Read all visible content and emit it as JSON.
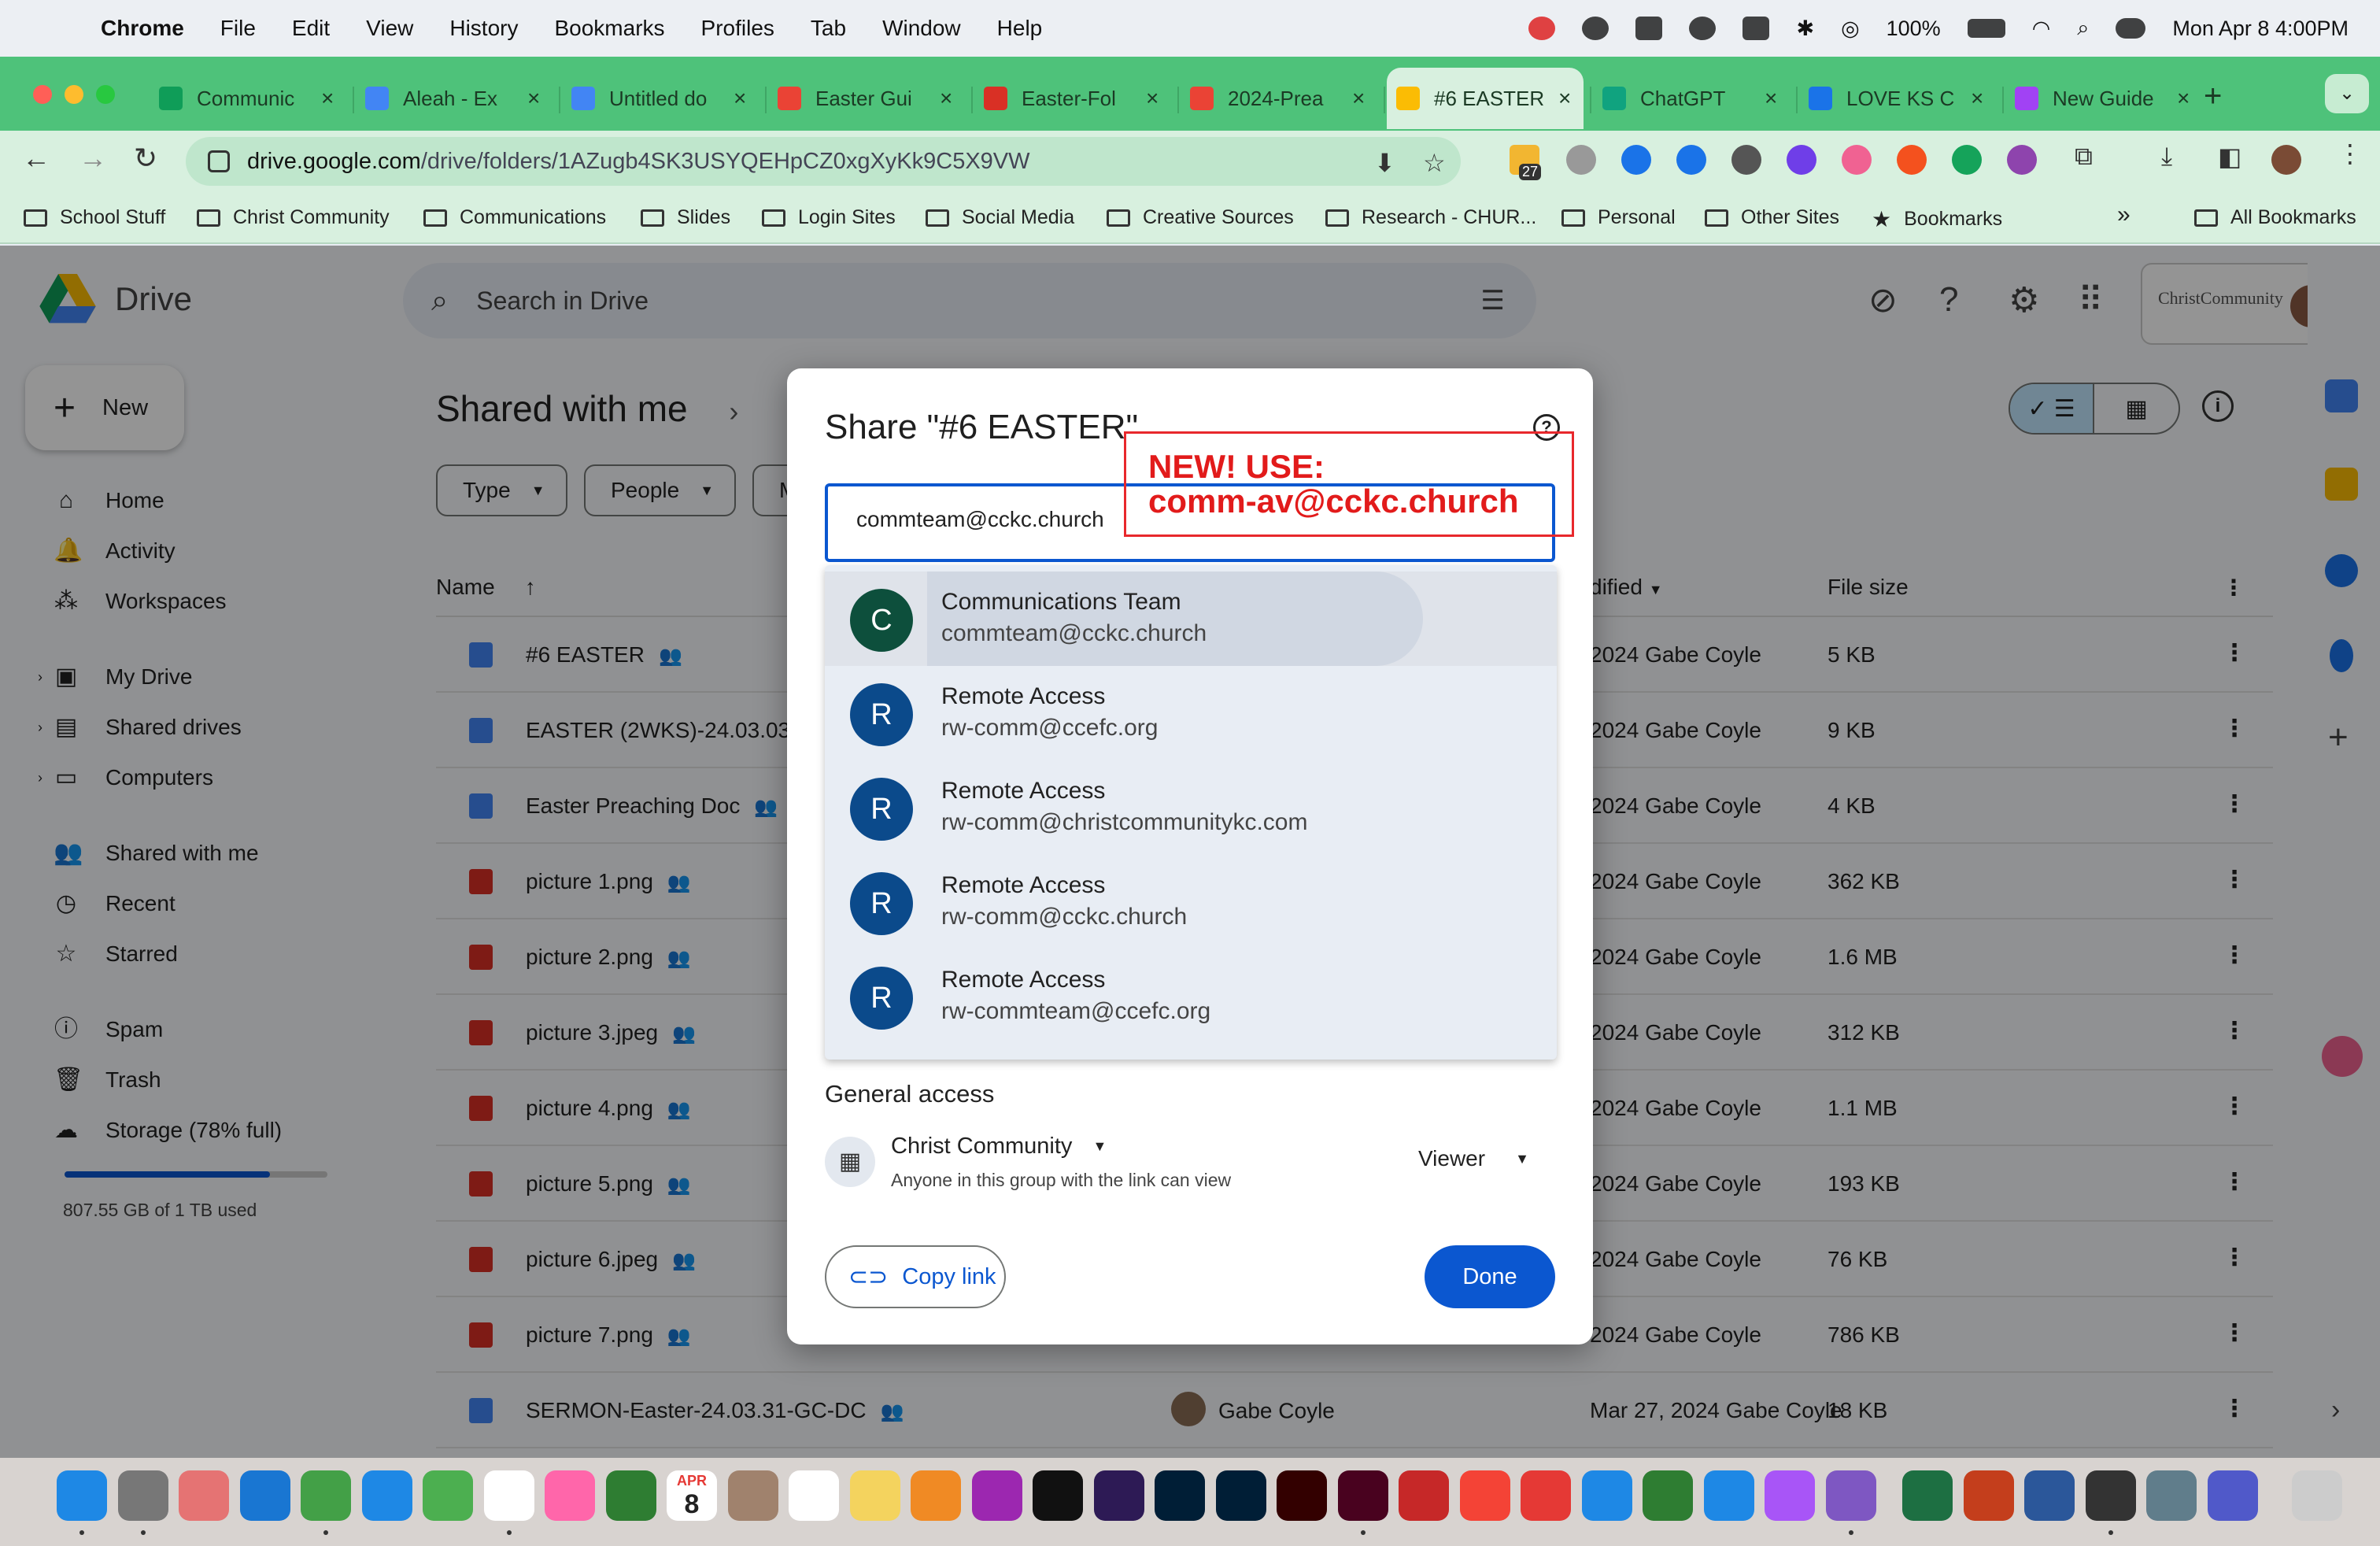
{
  "menubar": {
    "app": "Chrome",
    "items": [
      "File",
      "Edit",
      "View",
      "History",
      "Bookmarks",
      "Profiles",
      "Tab",
      "Window",
      "Help"
    ],
    "battery": "100%",
    "datetime": "Mon Apr 8  4:00PM"
  },
  "tabs": [
    {
      "title": "Communic",
      "color": "#0f9d58"
    },
    {
      "title": "Aleah - Ex",
      "color": "#4285f4"
    },
    {
      "title": "Untitled do",
      "color": "#4285f4"
    },
    {
      "title": "Easter Gui",
      "color": "#ea4335"
    },
    {
      "title": "Easter-Fol",
      "color": "#d93025"
    },
    {
      "title": "2024-Prea",
      "color": "#ea4335"
    },
    {
      "title": "#6 EASTER",
      "color": "#fbbc04"
    },
    {
      "title": "ChatGPT",
      "color": "#10a37f"
    },
    {
      "title": "LOVE KS C",
      "color": "#1a73e8"
    },
    {
      "title": "New Guide",
      "color": "#a142f4"
    }
  ],
  "omnibox": {
    "host": "drive.google.com",
    "path": "/drive/folders/1AZugb4SK3USYQEHpCZ0xgXyKk9C5X9VW",
    "ext_badge": "27"
  },
  "bookmarks": [
    "School Stuff",
    "Christ Community",
    "Communications",
    "Slides",
    "Login Sites",
    "Social Media",
    "Creative Sources",
    "Research - CHUR...",
    "Personal",
    "Other Sites",
    "Bookmarks"
  ],
  "bookmarks_more": "»",
  "bookmarks_all": "All Bookmarks",
  "drive": {
    "logo_text": "Drive",
    "search_placeholder": "Search in Drive",
    "new_label": "New",
    "account_org": "ChristCommunity",
    "nav": [
      {
        "label": "Home",
        "icon": "home-icon",
        "glyph": "⌂"
      },
      {
        "label": "Activity",
        "icon": "bell-icon",
        "glyph": "🔔"
      },
      {
        "label": "Workspaces",
        "icon": "workspaces-icon",
        "glyph": "⁂"
      },
      {
        "label": "My Drive",
        "icon": "my-drive-icon",
        "glyph": "▣"
      },
      {
        "label": "Shared drives",
        "icon": "shared-drives-icon",
        "glyph": "▤"
      },
      {
        "label": "Computers",
        "icon": "computers-icon",
        "glyph": "▭"
      },
      {
        "label": "Shared with me",
        "icon": "people-icon",
        "glyph": "👥"
      },
      {
        "label": "Recent",
        "icon": "clock-icon",
        "glyph": "◷"
      },
      {
        "label": "Starred",
        "icon": "star-icon",
        "glyph": "☆"
      },
      {
        "label": "Spam",
        "icon": "spam-icon",
        "glyph": "ⓘ"
      },
      {
        "label": "Trash",
        "icon": "trash-icon",
        "glyph": "🗑"
      },
      {
        "label": "Storage (78% full)",
        "icon": "cloud-icon",
        "glyph": "☁"
      }
    ],
    "storage_fraction": 0.78,
    "storage_used": "807.55 GB of 1 TB used",
    "breadcrumb": "Shared with me",
    "filters": [
      "Type",
      "People",
      "M"
    ],
    "columns": {
      "name": "Name",
      "modified": "dified",
      "size": "File size"
    },
    "files": [
      {
        "name": "#6 EASTER",
        "type": "doc",
        "owner": "",
        "modified": "2024 Gabe Coyle",
        "size": "5 KB"
      },
      {
        "name": "EASTER (2WKS)-24.03.03",
        "type": "doc",
        "owner": "",
        "modified": "2024 Gabe Coyle",
        "size": "9 KB"
      },
      {
        "name": "Easter Preaching Doc",
        "type": "doc",
        "owner": "",
        "modified": "2024 Gabe Coyle",
        "size": "4 KB"
      },
      {
        "name": "picture 1.png",
        "type": "img",
        "owner": "",
        "modified": "2024 Gabe Coyle",
        "size": "362 KB"
      },
      {
        "name": "picture 2.png",
        "type": "img",
        "owner": "",
        "modified": "2024 Gabe Coyle",
        "size": "1.6 MB"
      },
      {
        "name": "picture 3.jpeg",
        "type": "img",
        "owner": "",
        "modified": "2024 Gabe Coyle",
        "size": "312 KB"
      },
      {
        "name": "picture 4.png",
        "type": "img",
        "owner": "",
        "modified": "2024 Gabe Coyle",
        "size": "1.1 MB"
      },
      {
        "name": "picture 5.png",
        "type": "img",
        "owner": "",
        "modified": "2024 Gabe Coyle",
        "size": "193 KB"
      },
      {
        "name": "picture 6.jpeg",
        "type": "img",
        "owner": "",
        "modified": "2024 Gabe Coyle",
        "size": "76 KB"
      },
      {
        "name": "picture 7.png",
        "type": "img",
        "owner": "",
        "modified": "2024 Gabe Coyle",
        "size": "786 KB"
      },
      {
        "name": "SERMON-Easter-24.03.31-GC-DC",
        "type": "doc",
        "owner": "Gabe Coyle",
        "modified": "Mar 27, 2024 Gabe Coyle",
        "size": "18 KB"
      }
    ]
  },
  "share_dialog": {
    "title": "Share \"#6 EASTER\"",
    "input_value": "commteam@cckc.church",
    "suggestions": [
      {
        "initial": "C",
        "name": "Communications Team",
        "email": "commteam@cckc.church",
        "color": "#0d4f3c"
      },
      {
        "initial": "R",
        "name": "Remote Access",
        "email": "rw-comm@ccefc.org",
        "color": "#0b4a8b"
      },
      {
        "initial": "R",
        "name": "Remote Access",
        "email": "rw-comm@christcommunitykc.com",
        "color": "#0b4a8b"
      },
      {
        "initial": "R",
        "name": "Remote Access",
        "email": "rw-comm@cckc.church",
        "color": "#0b4a8b"
      },
      {
        "initial": "R",
        "name": "Remote Access",
        "email": "rw-commteam@ccefc.org",
        "color": "#0b4a8b"
      }
    ],
    "general_access_label": "General access",
    "org_name": "Christ Community",
    "org_desc": "Anyone in this group with the link can view",
    "role": "Viewer",
    "copy_link": "Copy link",
    "done": "Done"
  },
  "annotation": {
    "line1": "NEW! USE:",
    "line2": "comm-av@cckc.church",
    "color": "#e21b1b"
  },
  "dock": {
    "calendar_month": "APR",
    "calendar_day": "8",
    "apps": [
      "Finder",
      "System Settings",
      "Launchpad",
      "Safari",
      "Messages",
      "Mail",
      "Maps",
      "Chrome",
      "Photos",
      "FaceTime",
      "Calendar",
      "Contacts",
      "Reminders",
      "Notes",
      "Pages",
      "Podcasts",
      "TV",
      "Dw",
      "Lr",
      "Ps",
      "Ai",
      "Id",
      "Acrobat",
      "Music",
      "News",
      "Keynote",
      "Numbers",
      "App Store",
      "ClickUp",
      "Business",
      "Excel",
      "PowerPoint",
      "Word",
      "Creative Cloud",
      "Preview",
      "Teams",
      "Trash"
    ]
  }
}
